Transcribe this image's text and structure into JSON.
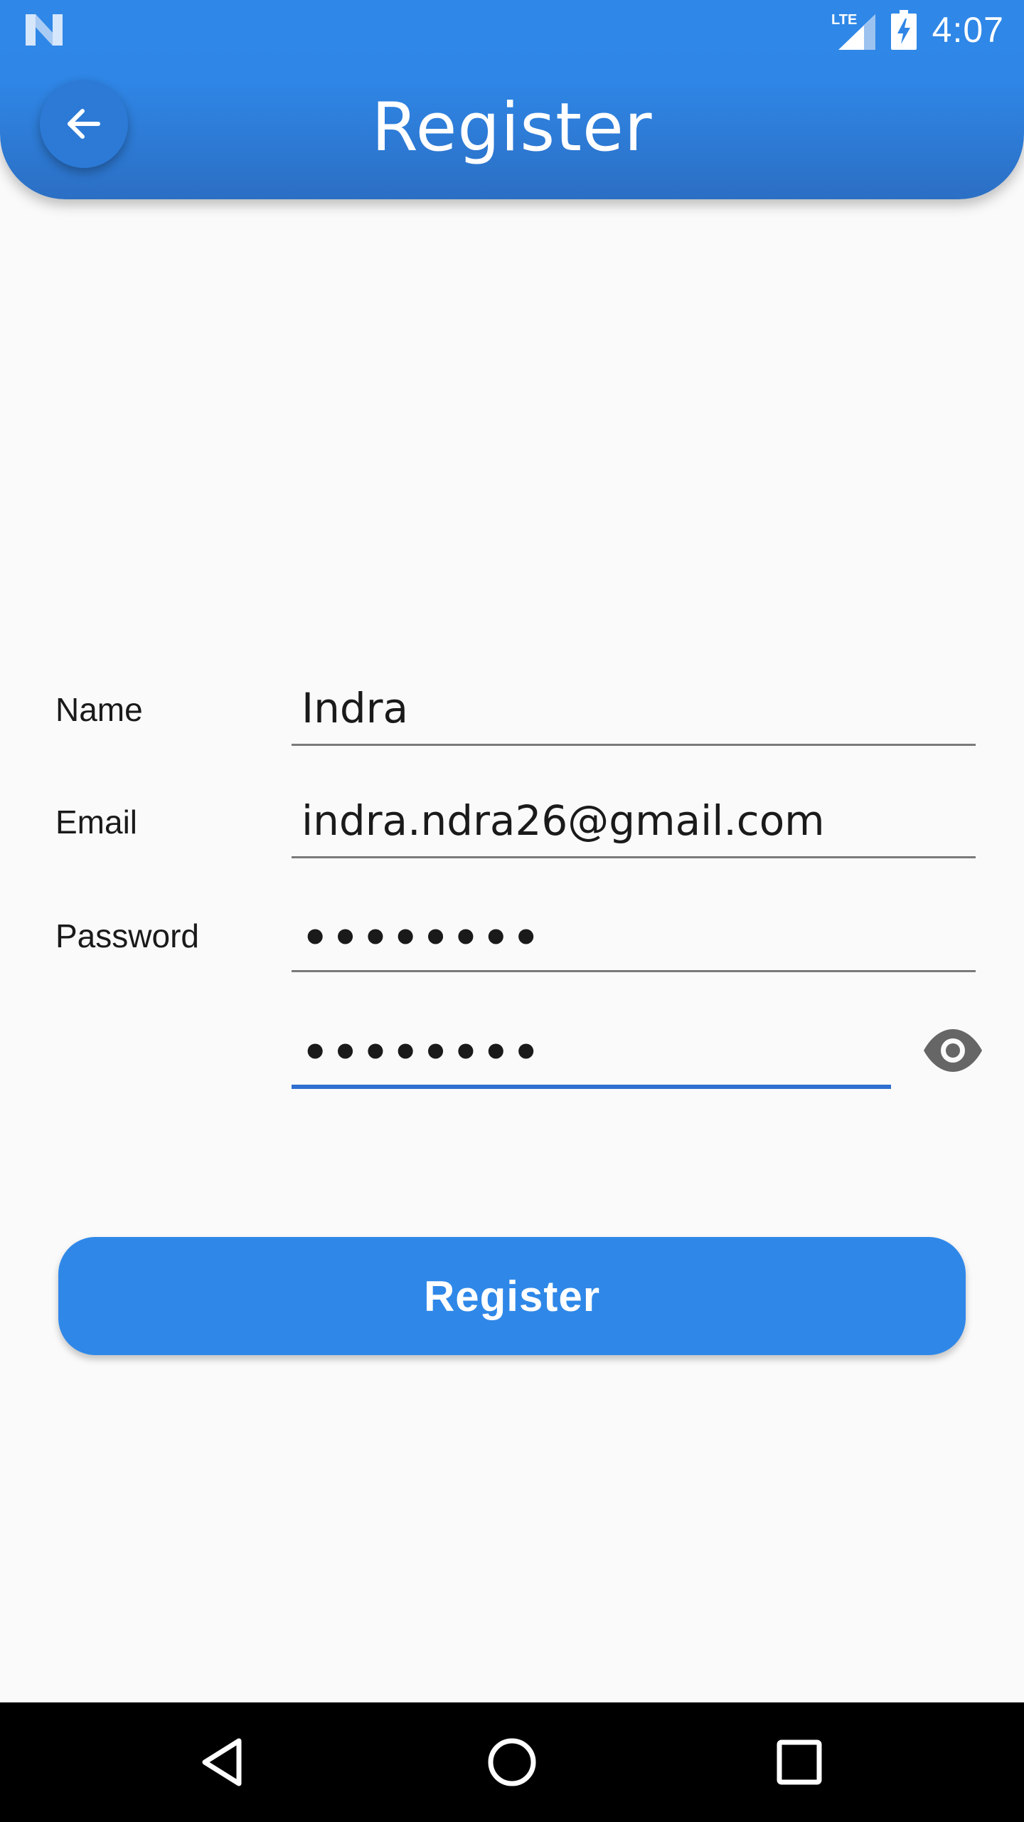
{
  "status_bar": {
    "time": "4:07",
    "network_label": "LTE",
    "icons": [
      "n-logo-icon",
      "signal-icon",
      "battery-charging-icon"
    ]
  },
  "app_bar": {
    "title": "Register",
    "back_icon": "arrow-left-icon"
  },
  "form": {
    "name": {
      "label": "Name",
      "value": "Indra"
    },
    "email": {
      "label": "Email",
      "value": "indra.ndra26@gmail.com"
    },
    "password": {
      "label": "Password",
      "value": "••••••••"
    },
    "confirm_password": {
      "label": "",
      "value": "••••••••",
      "toggle_icon": "eye-icon"
    }
  },
  "register_button": {
    "label": "Register"
  },
  "nav_bar": {
    "icons": [
      "back-triangle-icon",
      "home-circle-icon",
      "recents-square-icon"
    ]
  },
  "colors": {
    "primary": "#2f88e8",
    "primary_dark": "#2b6fc4",
    "focus_underline": "#2f6fd0",
    "background": "#fafafa"
  }
}
